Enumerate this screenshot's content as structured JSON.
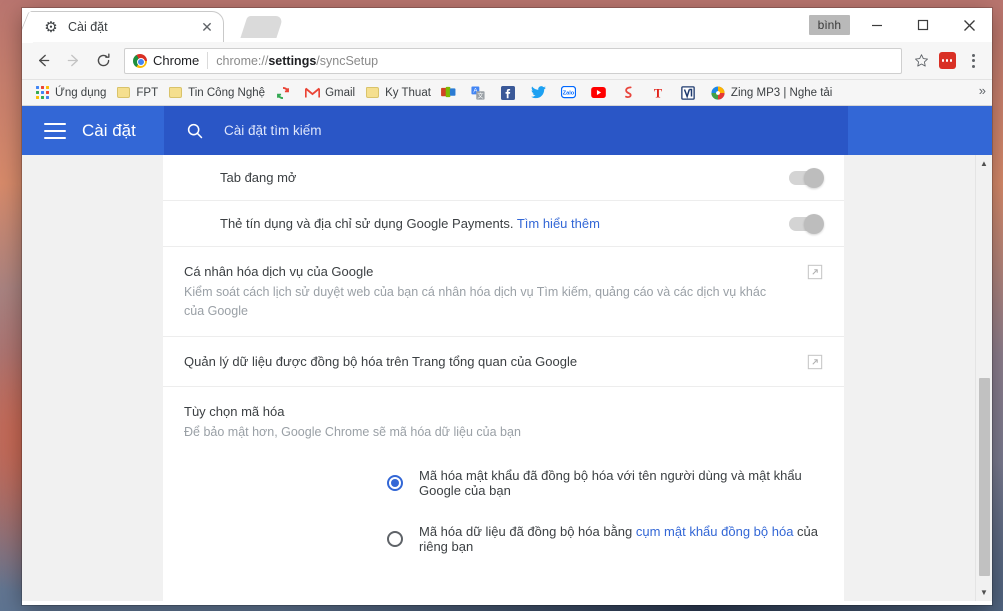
{
  "window": {
    "profile_chip": "bình",
    "minimize": "−",
    "maximize": "▢",
    "close": "✕"
  },
  "tab": {
    "title": "Cài đặt",
    "favicon": "gear-icon",
    "close": "✕",
    "new_tab": "new-tab-icon"
  },
  "toolbar": {
    "back": "←",
    "forward": "→",
    "reload": "⟳",
    "chrome_badge": "Chrome",
    "url_prefix": "chrome://",
    "url_bold": "settings",
    "url_suffix": "/syncSetup",
    "star": "☆",
    "extension": "extension-icon",
    "menu": "overflow-menu-icon"
  },
  "bookmarks": {
    "apps_label": "Ứng dụng",
    "overflow": "»",
    "items": [
      {
        "label": "FPT",
        "icon": "folder-icon",
        "color": "#f5df8e"
      },
      {
        "label": "Tin Công Nghệ",
        "icon": "folder-icon",
        "color": "#f5df8e"
      },
      {
        "label": "",
        "icon": "sync-icon",
        "color": "#34a853"
      },
      {
        "label": "Gmail",
        "icon": "gmail-icon",
        "color": "#ea4335"
      },
      {
        "label": "Ky Thuat",
        "icon": "folder-icon",
        "color": "#f5df8e"
      },
      {
        "label": "",
        "icon": "office-icon",
        "color": "#d04423"
      },
      {
        "label": "",
        "icon": "google-translate-icon",
        "color": "#4285f4"
      },
      {
        "label": "",
        "icon": "facebook-icon",
        "color": "#3b5998"
      },
      {
        "label": "",
        "icon": "twitter-icon",
        "color": "#1da1f2"
      },
      {
        "label": "",
        "icon": "zalo-icon",
        "color": "#0068ff"
      },
      {
        "label": "",
        "icon": "youtube-icon",
        "color": "#ff0000"
      },
      {
        "label": "",
        "icon": "sticker-icon",
        "color": "#e8453c"
      },
      {
        "label": "",
        "icon": "tinhte-icon",
        "color": "#e2231a"
      },
      {
        "label": "",
        "icon": "vnexpress-icon",
        "color": "#1e3a6e"
      },
      {
        "label": "Zing MP3 | Nghe tải",
        "icon": "zing-mp3-icon",
        "color": "#1e88e5"
      }
    ]
  },
  "settings": {
    "title": "Cài đặt",
    "menu_icon": "hamburger-icon",
    "search_icon": "search-icon",
    "search_placeholder": "Cài đặt tìm kiếm",
    "search_value": ""
  },
  "rows": [
    {
      "label": "Tab đang mở",
      "toggle": "on-disabled"
    }
  ],
  "payments_row": {
    "label": "Thẻ tín dụng và địa chỉ sử dụng Google Payments.",
    "link": "Tìm hiểu thêm",
    "toggle": "on-disabled"
  },
  "personalization": {
    "title": "Cá nhân hóa dịch vụ của Google",
    "subtitle": "Kiểm soát cách lịch sử duyệt web của bạn cá nhân hóa dịch vụ Tìm kiếm, quảng cáo và các dịch vụ khác của Google",
    "icon": "external-link-icon"
  },
  "dashboard": {
    "title": "Quản lý dữ liệu được đồng bộ hóa trên Trang tổng quan của Google",
    "icon": "external-link-icon"
  },
  "encryption": {
    "title": "Tùy chọn mã hóa",
    "subtitle": "Để bảo mật hơn, Google Chrome sẽ mã hóa dữ liệu của bạn",
    "options": [
      {
        "selected": true,
        "text": "Mã hóa mật khẩu đã đồng bộ hóa với tên người dùng và mật khẩu Google của bạn",
        "link": "",
        "text_after": ""
      },
      {
        "selected": false,
        "text": "Mã hóa dữ liệu đã đồng bộ hóa bằng ",
        "link": "cụm mật khẩu đồng bộ hóa",
        "text_after": " của riêng bạn"
      }
    ]
  },
  "scrollbar": {
    "up": "▲",
    "down": "▼"
  },
  "colors": {
    "header_blue": "#3367d6",
    "search_blue": "#2a56c6",
    "link_blue": "#3367d6",
    "radio_blue": "#3367d6",
    "card_white": "#ffffff",
    "page_gray": "#f1f1f1"
  }
}
